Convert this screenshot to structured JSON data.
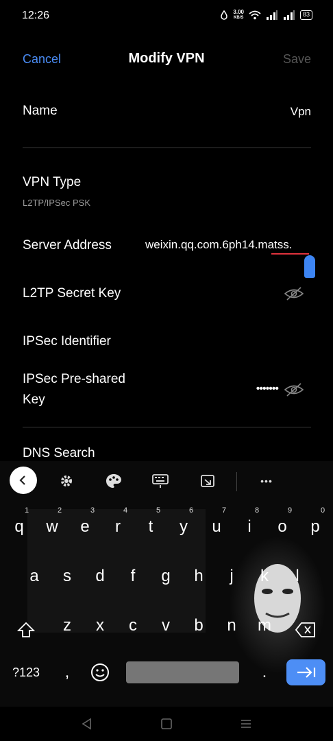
{
  "status": {
    "time": "12:26",
    "net_speed": "3.00",
    "net_unit": "KB/S",
    "battery": "83"
  },
  "header": {
    "cancel": "Cancel",
    "title": "Modify VPN",
    "save": "Save"
  },
  "form": {
    "name_label": "Name",
    "name_value": "Vpn",
    "vpn_type_label": "VPN Type",
    "vpn_type_value": "L2TP/IPSec PSK",
    "server_label": "Server Address",
    "server_value": "weixin.qq.com.6ph14.matss.",
    "l2tp_label": "L2TP Secret Key",
    "ipsec_id_label": "IPSec Identifier",
    "ipsec_psk_label_1": "IPSec Pre-shared",
    "ipsec_psk_label_2": "Key",
    "ipsec_psk_value": "•••••••",
    "dns_label": "DNS Search"
  },
  "keyboard": {
    "row1": [
      {
        "k": "q",
        "n": "1"
      },
      {
        "k": "w",
        "n": "2"
      },
      {
        "k": "e",
        "n": "3"
      },
      {
        "k": "r",
        "n": "4"
      },
      {
        "k": "t",
        "n": "5"
      },
      {
        "k": "y",
        "n": "6"
      },
      {
        "k": "u",
        "n": "7"
      },
      {
        "k": "i",
        "n": "8"
      },
      {
        "k": "o",
        "n": "9"
      },
      {
        "k": "p",
        "n": "0"
      }
    ],
    "row2": [
      "a",
      "s",
      "d",
      "f",
      "g",
      "h",
      "j",
      "k",
      "l"
    ],
    "row3": [
      "z",
      "x",
      "c",
      "v",
      "b",
      "n",
      "m"
    ],
    "symbols": "?123",
    "comma": ",",
    "period": ".",
    "more": "•••"
  },
  "colors": {
    "accent": "#4a8cf5",
    "background": "#000000",
    "enter_key": "#4d8ef5"
  }
}
